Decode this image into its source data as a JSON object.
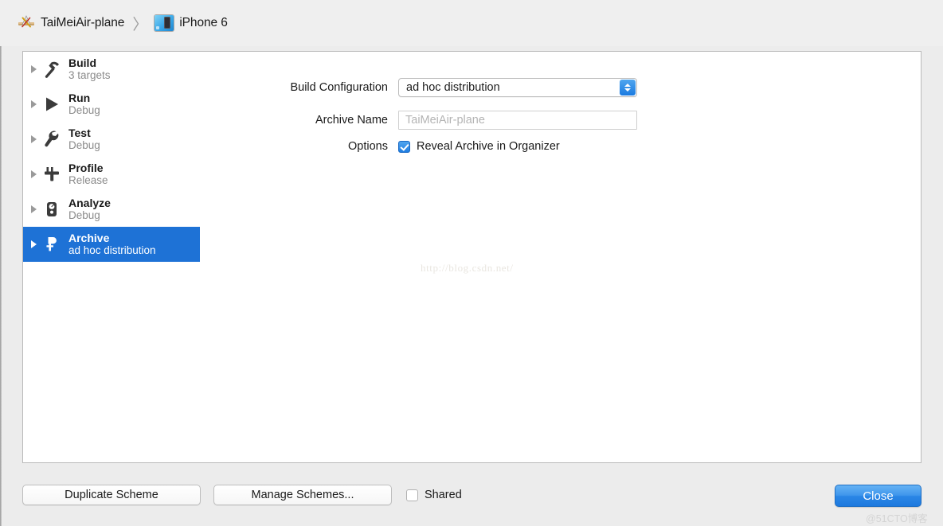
{
  "breadcrumb": {
    "project_icon": "xcode-app-icon",
    "project": "TaiMeiAir-plane",
    "separator": "〉",
    "destination_icon": "simulator-icon",
    "destination": "iPhone 6"
  },
  "sidebar": {
    "items": [
      {
        "icon": "hammer-icon",
        "title": "Build",
        "subtitle": "3 targets",
        "selected": false
      },
      {
        "icon": "play-icon",
        "title": "Run",
        "subtitle": "Debug",
        "selected": false
      },
      {
        "icon": "wrench-icon",
        "title": "Test",
        "subtitle": "Debug",
        "selected": false
      },
      {
        "icon": "caliper-icon",
        "title": "Profile",
        "subtitle": "Release",
        "selected": false
      },
      {
        "icon": "gauge-icon",
        "title": "Analyze",
        "subtitle": "Debug",
        "selected": false
      },
      {
        "icon": "archive-icon",
        "title": "Archive",
        "subtitle": "ad hoc distribution",
        "selected": true
      }
    ]
  },
  "form": {
    "build_configuration": {
      "label": "Build Configuration",
      "value": "ad hoc distribution"
    },
    "archive_name": {
      "label": "Archive Name",
      "value": "",
      "placeholder": "TaiMeiAir-plane"
    },
    "options": {
      "label": "Options",
      "checkbox_label": "Reveal Archive in Organizer",
      "checked": true
    }
  },
  "watermarks": {
    "center": "http://blog.csdn.net/",
    "corner": "@51CTO博客"
  },
  "footer": {
    "duplicate_scheme": "Duplicate Scheme",
    "manage_schemes": "Manage Schemes...",
    "shared_label": "Shared",
    "shared_checked": false,
    "close": "Close"
  },
  "colors": {
    "selection_blue": "#1e72d6",
    "accent_blue": "#2a86e6",
    "window_bg": "#ececec"
  }
}
